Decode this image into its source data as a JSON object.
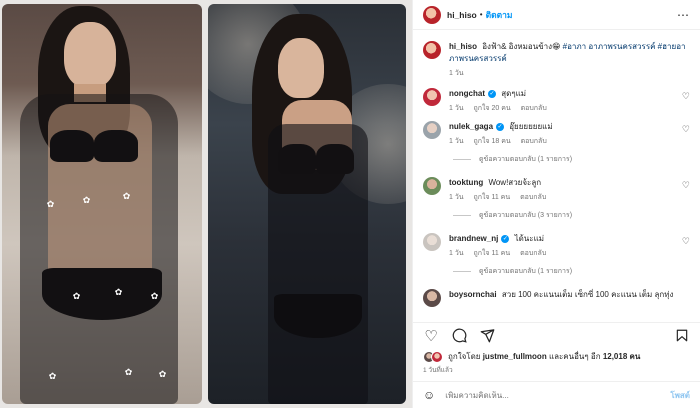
{
  "post": {
    "username": "hi_hiso",
    "follow_label": "ติดตาม",
    "more_icon": "more-horizontal-icon",
    "caption_user": "hi_hiso",
    "caption_text": "อิงฟ้า& อิงหมอนข้าง😁",
    "caption_tags": "#อาภา อาภาพรนครสวรรค์ #ฮายอาภาพรนครสวรรค์",
    "caption_time": "1 วัน"
  },
  "comments": [
    {
      "user": "nongchat",
      "verified": true,
      "text": "สุดๆแม่",
      "time": "1 วัน",
      "likes": "ถูกใจ 20 คน",
      "reply_label": "ตอบกลับ",
      "view_replies": ""
    },
    {
      "user": "nulek_gaga",
      "verified": true,
      "text": "อุ๊ยยยยยยแม่",
      "time": "1 วัน",
      "likes": "ถูกใจ 18 คน",
      "reply_label": "ตอบกลับ",
      "view_replies": "ดูข้อความตอบกลับ (1 รายการ)"
    },
    {
      "user": "tooktung",
      "verified": false,
      "text": "Wow!สวยจ้ะลูก",
      "time": "1 วัน",
      "likes": "ถูกใจ 11 คน",
      "reply_label": "ตอบกลับ",
      "view_replies": "ดูข้อความตอบกลับ (3 รายการ)"
    },
    {
      "user": "brandnew_nj",
      "verified": true,
      "text": "ได้นะแม่",
      "time": "1 วัน",
      "likes": "ถูกใจ 11 คน",
      "reply_label": "ตอบกลับ",
      "view_replies": "ดูข้อความตอบกลับ (1 รายการ)"
    },
    {
      "user": "boysornchai",
      "verified": false,
      "text": "สวย 100 คะแนนเต็ม เซ็กซี่ 100 คะแนน เต็ม ลุกทุ่ง",
      "time": "",
      "likes": "",
      "reply_label": "",
      "view_replies": ""
    }
  ],
  "likes_summary": {
    "prefix": "ถูกใจโดย",
    "user": "justme_fullmoon",
    "middle": "และคนอื่นๆ อีก",
    "count": "12,018 คน"
  },
  "posted_ago": "1 วันที่แล้ว",
  "composer": {
    "placeholder": "เพิ่มความคิดเห็น...",
    "post_label": "โพสต์"
  },
  "icons": {
    "like": "heart-icon",
    "comment": "comment-icon",
    "share": "share-icon",
    "save": "bookmark-icon",
    "emoji": "emoji-icon"
  },
  "colors": {
    "link_blue": "#0095f6",
    "post_button_disabled": "#8ec5f0",
    "secondary_text": "#737373"
  }
}
